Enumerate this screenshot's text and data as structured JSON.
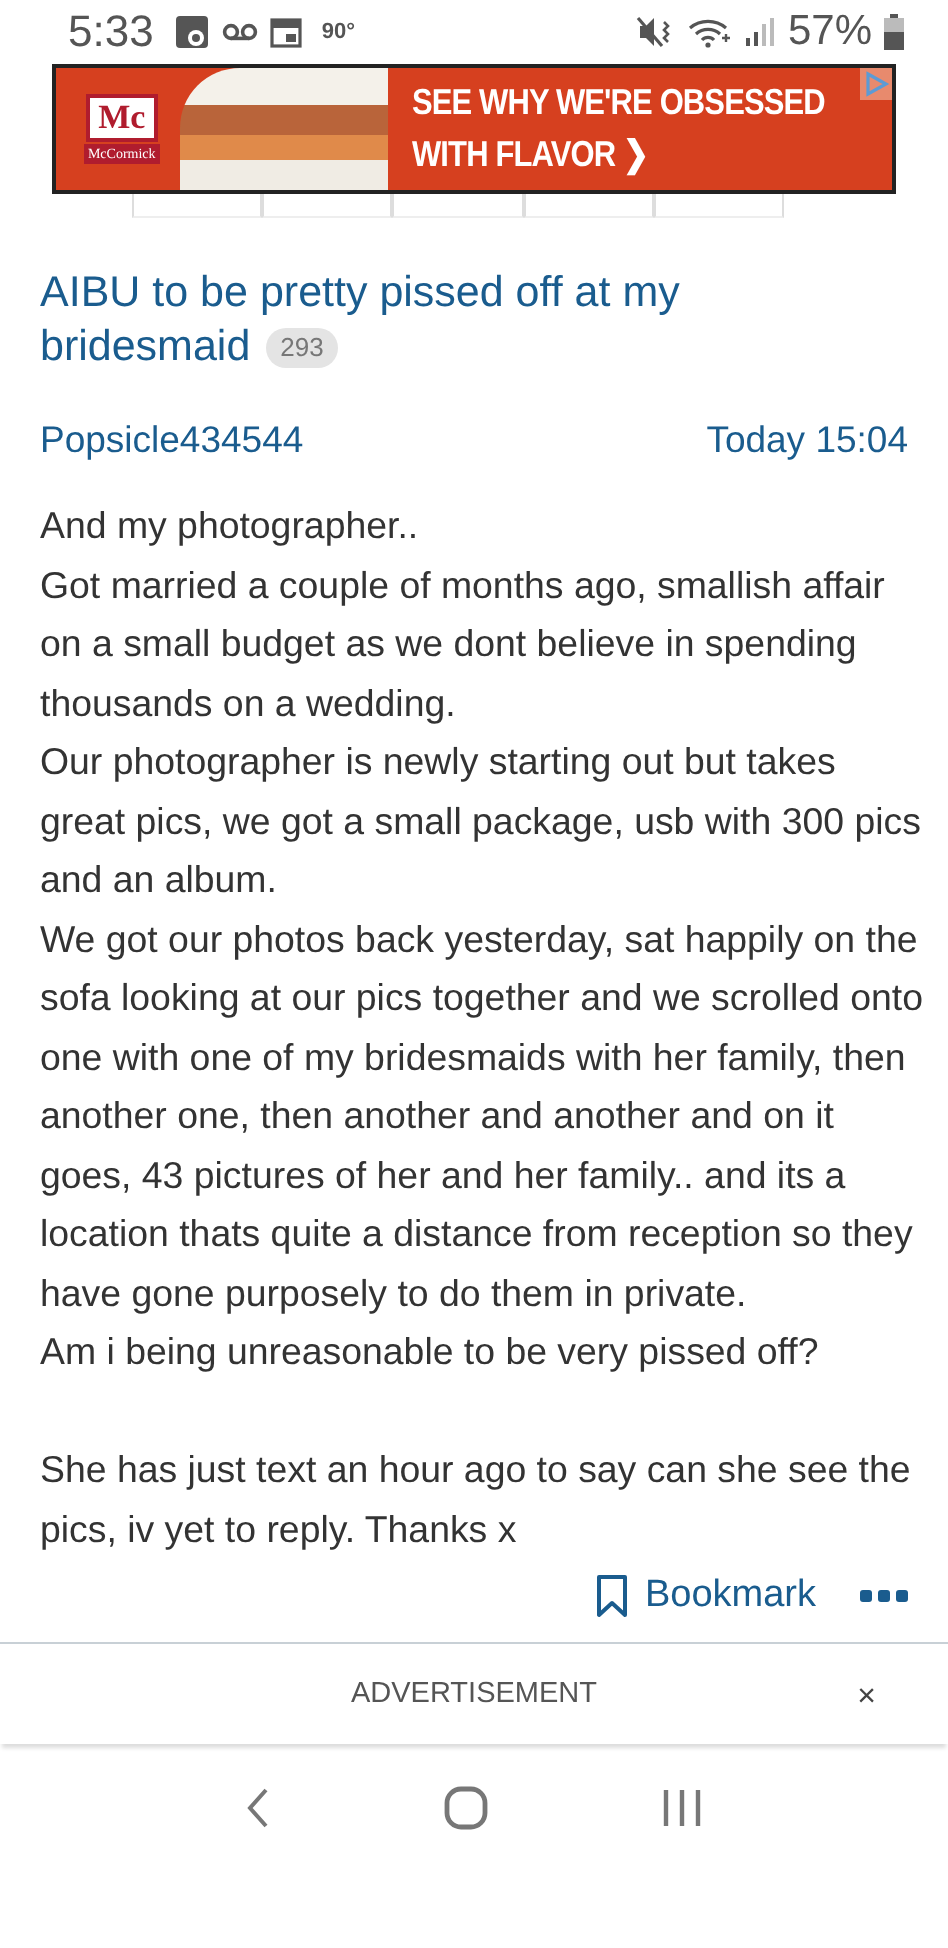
{
  "status_bar": {
    "time": "5:33",
    "temperature": "90°",
    "battery": "57%"
  },
  "ad_banner": {
    "brand_mark": "Mc",
    "brand": "McCormick",
    "headline": "SEE WHY WE'RE OBSESSED",
    "subline": "WITH FLAVOR ❯"
  },
  "thread": {
    "title_lines": [
      "AIBU to be pretty pissed off at my",
      "bridesmaid"
    ],
    "reply_count": "293"
  },
  "post": {
    "author": "Popsicle434544",
    "time": "Today 15:04",
    "paragraphs": [
      {
        "text": "And my photographer..",
        "space_before": false
      },
      {
        "text": "Got married a couple of months ago, smallish affair on a small budget as we dont believe in spending thousands on a wedding.",
        "space_before": false
      },
      {
        "text": "Our photographer is newly starting out but takes great pics, we got a small package, usb with 300 pics and an album.",
        "space_before": false
      },
      {
        "text": "We got our photos back yesterday, sat happily on the sofa looking at our pics together and we scrolled onto one with one of my bridesmaids with her family, then another one, then another and another and on it goes, 43 pictures of her and her family.. and its a location thats quite a distance from reception so they have gone purposely to do them in private.",
        "space_before": false
      },
      {
        "text": "Am i being unreasonable to be very pissed off?",
        "space_before": false
      },
      {
        "text": "She has just text an hour ago to say can she see the pics, iv yet to reply. Thanks x",
        "space_before": true
      }
    ],
    "bookmark_label": "Bookmark"
  },
  "advertisement": {
    "label": "ADVERTISEMENT",
    "close": "×"
  }
}
